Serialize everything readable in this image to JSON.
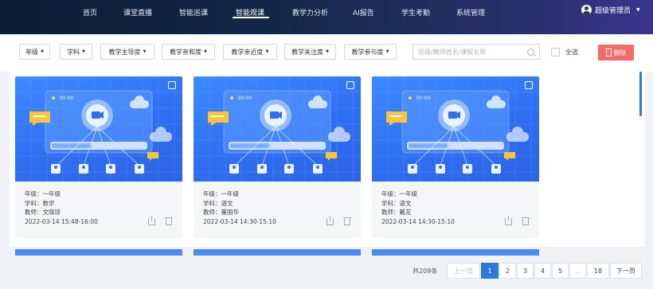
{
  "nav": {
    "items": [
      {
        "label": "首页"
      },
      {
        "label": "课堂直播"
      },
      {
        "label": "智能巡课"
      },
      {
        "label": "智能观课"
      },
      {
        "label": "教学力分析"
      },
      {
        "label": "AI报告"
      },
      {
        "label": "学生考勤"
      },
      {
        "label": "系统管理"
      }
    ],
    "active_index": 3,
    "user_name": "超级管理员"
  },
  "filters": {
    "dropdowns": [
      {
        "label": "年级"
      },
      {
        "label": "学科"
      },
      {
        "label": "教学主导度"
      },
      {
        "label": "教学亲和度"
      },
      {
        "label": "教学亲近度"
      },
      {
        "label": "教学关注度"
      },
      {
        "label": "教学参与度"
      }
    ],
    "search_placeholder": "班级/教师姓名/课程名称",
    "select_all_label": "全选",
    "delete_label": "删除"
  },
  "cards": [
    {
      "thumb_time": "30:00",
      "grade": "年级：一年级",
      "subject": "学科：数学",
      "teacher": "教师：文晓琼",
      "time": "2022-03-14 15:48-16:00"
    },
    {
      "thumb_time": "30:00",
      "grade": "年级：一年级",
      "subject": "学科：语文",
      "teacher": "教师：董国华",
      "time": "2022-03-14 14:30-15:10"
    },
    {
      "thumb_time": "30:00",
      "grade": "年级：一年级",
      "subject": "学科：语文",
      "teacher": "教师：戴花",
      "time": "2022-03-14 14:30-15:10"
    }
  ],
  "pagination": {
    "total": "共209条",
    "prev": "上一页",
    "pages": [
      "1",
      "2",
      "3",
      "4",
      "5",
      "...",
      "18"
    ],
    "active": "1",
    "next": "下一页"
  },
  "colors": {
    "accent": "#2c7ad6",
    "delete": "#f26b6b",
    "header_dark": "#0c1c36",
    "header_purple": "#3a3590"
  }
}
